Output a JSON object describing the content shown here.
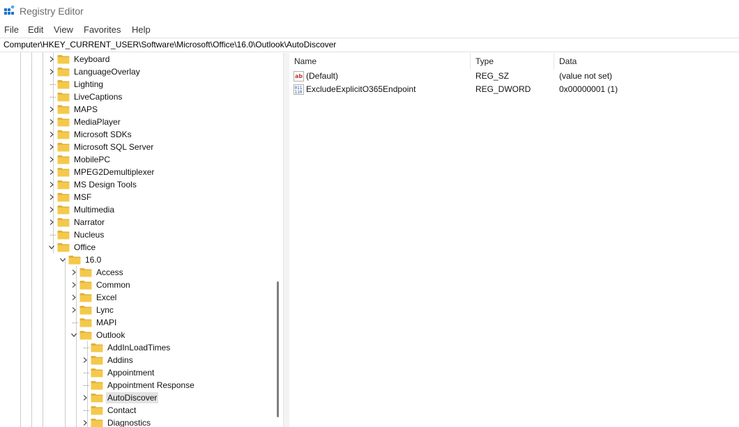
{
  "window": {
    "title": "Registry Editor"
  },
  "menu": [
    "File",
    "Edit",
    "View",
    "Favorites",
    "Help"
  ],
  "address": "Computer\\HKEY_CURRENT_USER\\Software\\Microsoft\\Office\\16.0\\Outlook\\AutoDiscover",
  "tree": [
    {
      "label": "Keyboard",
      "expander": "collapsed",
      "level": 0
    },
    {
      "label": "LanguageOverlay",
      "expander": "collapsed",
      "level": 0
    },
    {
      "label": "Lighting",
      "expander": "none",
      "level": 0
    },
    {
      "label": "LiveCaptions",
      "expander": "none",
      "level": 0
    },
    {
      "label": "MAPS",
      "expander": "collapsed",
      "level": 0
    },
    {
      "label": "MediaPlayer",
      "expander": "collapsed",
      "level": 0
    },
    {
      "label": "Microsoft SDKs",
      "expander": "collapsed",
      "level": 0
    },
    {
      "label": "Microsoft SQL Server",
      "expander": "collapsed",
      "level": 0
    },
    {
      "label": "MobilePC",
      "expander": "collapsed",
      "level": 0
    },
    {
      "label": "MPEG2Demultiplexer",
      "expander": "collapsed",
      "level": 0
    },
    {
      "label": "MS Design Tools",
      "expander": "collapsed",
      "level": 0
    },
    {
      "label": "MSF",
      "expander": "collapsed",
      "level": 0
    },
    {
      "label": "Multimedia",
      "expander": "collapsed",
      "level": 0
    },
    {
      "label": "Narrator",
      "expander": "collapsed",
      "level": 0
    },
    {
      "label": "Nucleus",
      "expander": "none",
      "level": 0
    },
    {
      "label": "Office",
      "expander": "expanded",
      "level": 0
    },
    {
      "label": "16.0",
      "expander": "expanded",
      "level": 1
    },
    {
      "label": "Access",
      "expander": "collapsed",
      "level": 2
    },
    {
      "label": "Common",
      "expander": "collapsed",
      "level": 2
    },
    {
      "label": "Excel",
      "expander": "collapsed",
      "level": 2
    },
    {
      "label": "Lync",
      "expander": "collapsed",
      "level": 2
    },
    {
      "label": "MAPI",
      "expander": "none",
      "level": 2
    },
    {
      "label": "Outlook",
      "expander": "expanded",
      "level": 2
    },
    {
      "label": "AddInLoadTimes",
      "expander": "none",
      "level": 3
    },
    {
      "label": "Addins",
      "expander": "collapsed",
      "level": 3
    },
    {
      "label": "Appointment",
      "expander": "none",
      "level": 3
    },
    {
      "label": "Appointment Response",
      "expander": "none",
      "level": 3
    },
    {
      "label": "AutoDiscover",
      "expander": "collapsed",
      "level": 3,
      "selected": true
    },
    {
      "label": "Contact",
      "expander": "none",
      "level": 3
    },
    {
      "label": "Diagnostics",
      "expander": "collapsed",
      "level": 3
    }
  ],
  "columns": {
    "name": "Name",
    "type": "Type",
    "data": "Data"
  },
  "values": [
    {
      "icon": "string-value-icon",
      "name": "(Default)",
      "type": "REG_SZ",
      "data": "(value not set)"
    },
    {
      "icon": "binary-value-icon",
      "name": "ExcludeExplicitO365Endpoint",
      "type": "REG_DWORD",
      "data": "0x00000001 (1)"
    }
  ],
  "colors": {
    "folder": "#f4c94b",
    "folder_dark": "#e3b13a",
    "selection": "#e3e3e3"
  }
}
